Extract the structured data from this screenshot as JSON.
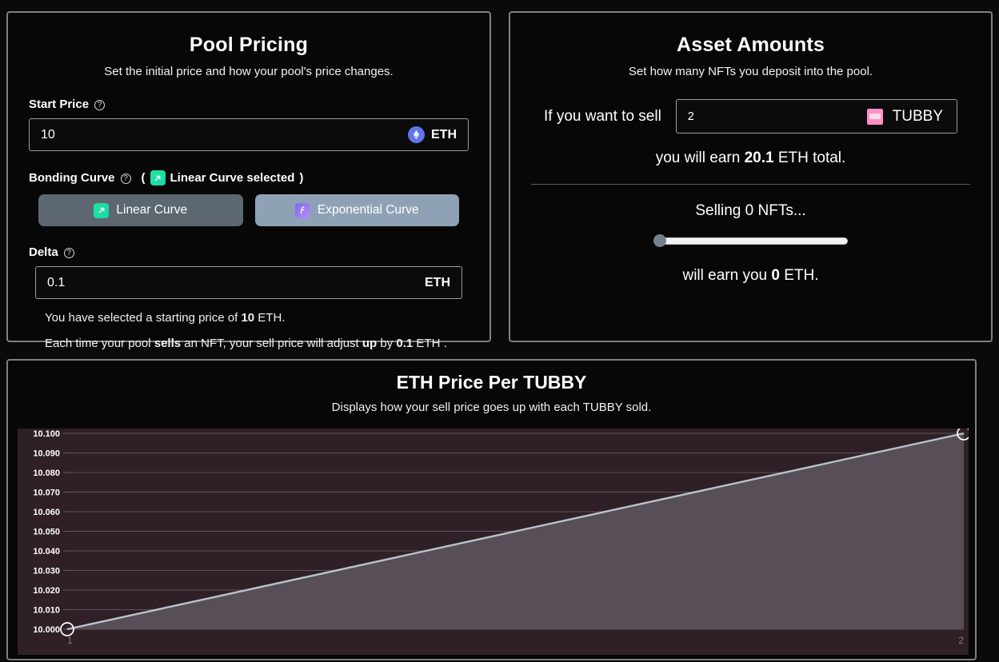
{
  "pool_pricing": {
    "title": "Pool Pricing",
    "subtitle": "Set the initial price and how your pool's price changes.",
    "start_price": {
      "label": "Start Price",
      "help_icon": "question-circle-icon",
      "value": "10",
      "currency": "ETH",
      "currency_icon": "ethereum-icon"
    },
    "bonding_curve": {
      "label": "Bonding Curve",
      "help_icon": "question-circle-icon",
      "selected_note_open": "(",
      "selected_note": "Linear Curve selected",
      "selected_note_close": ")",
      "selected_icon": "linear-curve-icon",
      "options": [
        {
          "label": "Linear Curve",
          "icon": "linear-curve-icon",
          "selected": true
        },
        {
          "label": "Exponential Curve",
          "icon": "exponential-curve-icon",
          "selected": false
        }
      ]
    },
    "delta": {
      "label": "Delta",
      "help_icon": "question-circle-icon",
      "value": "0.1",
      "currency": "ETH"
    },
    "helper_1": {
      "prefix": "You have selected a starting price of ",
      "bold": "10",
      "suffix": " ETH."
    },
    "helper_2": {
      "p1": "Each time your pool ",
      "b1": "sells",
      "p2": " an NFT, your sell price will adjust ",
      "b2": "up",
      "p3": " by ",
      "b3": "0.1",
      "p4": " ETH ."
    }
  },
  "asset_amounts": {
    "title": "Asset Amounts",
    "subtitle": "Set how many NFTs you deposit into the pool.",
    "sell_label": "If you want to sell",
    "sell_value": "2",
    "token_symbol": "TUBBY",
    "token_icon": "tubby-nft-icon",
    "earn_line": {
      "prefix": "you will earn ",
      "bold": "20.1",
      "suffix": " ETH total."
    },
    "selling_line": "Selling 0 NFTs...",
    "slider": {
      "value": 0,
      "min": 0,
      "max": 2
    },
    "will_earn_line": {
      "prefix": "will earn you ",
      "bold": "0",
      "suffix": " ETH."
    }
  },
  "chart_data": {
    "type": "line",
    "title": "ETH Price Per TUBBY",
    "subtitle": "Displays how your sell price goes up with each TUBBY sold.",
    "xlabel": "",
    "ylabel": "",
    "x": [
      1,
      2
    ],
    "values": [
      10.0,
      10.1
    ],
    "categories": [
      "1",
      "2"
    ],
    "xtick_labels": [
      "1",
      "2"
    ],
    "ytick_labels": [
      "10.100",
      "10.090",
      "10.080",
      "10.070",
      "10.060",
      "10.050",
      "10.040",
      "10.030",
      "10.020",
      "10.010",
      "10.000"
    ],
    "ylim": [
      10.0,
      10.1
    ],
    "xlim": [
      1,
      2
    ],
    "grid": true,
    "legend": "none",
    "colors": {
      "plot_background": "#2e2026",
      "area_fill": "#584e57",
      "line": "#b9c2cc",
      "gridline": "#6a5a61",
      "marker_stroke": "#ffffff"
    }
  },
  "theme": {
    "page_background": "#0a0a0a",
    "panel_border": "#808080",
    "accent_green": "#22e39a",
    "accent_blue": "#7b6bf0",
    "eth_blue": "#6275e8",
    "tubby_pink": "#ff8fc7"
  }
}
